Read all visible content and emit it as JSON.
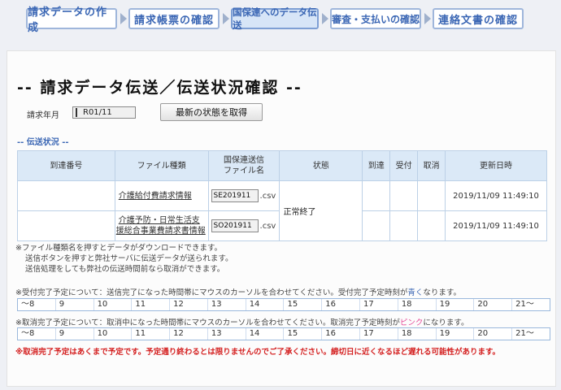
{
  "steps": [
    {
      "label": "請求データの作成",
      "active": false
    },
    {
      "label": "請求帳票の確認",
      "active": false
    },
    {
      "label": "国保連へのデータ伝送",
      "active": true
    },
    {
      "label": "審査・支払いの確認",
      "active": false
    },
    {
      "label": "連絡文書の確認",
      "active": false
    }
  ],
  "page_title": "-- 請求データ伝送／伝送状況確認 --",
  "billing_month": {
    "label": "請求年月",
    "value": "R01/11"
  },
  "refresh_button": "最新の状態を取得",
  "status_section": "-- 伝送状況 --",
  "table": {
    "headers": [
      "到達番号",
      "ファイル種類",
      "国保連送信\nファイル名",
      "状態",
      "到達",
      "受付",
      "取消",
      "更新日時"
    ],
    "rows": [
      {
        "arrival_no": "",
        "file_type": "介護給付費請求情報",
        "file_name": "SE201911",
        "ext": ".csv",
        "state": "",
        "arrived": "",
        "accepted": "",
        "cancelled": "",
        "updated": "2019/11/09 11:49:10"
      },
      {
        "arrival_no": "",
        "file_type": "介護予防・日常生活支援総合事業費請求書情報",
        "file_name": "SO201911",
        "ext": ".csv",
        "state": "",
        "arrived": "",
        "accepted": "",
        "cancelled": "",
        "updated": "2019/11/09 11:49:10"
      }
    ],
    "merged_state": "正常終了"
  },
  "notes": [
    "※ファイル種類名を押すとデータがダウンロードできます。",
    "送信ボタンを押すと弊社サーバに伝送データが送られます。",
    "送信処理をしても弊社の伝送時間前なら取消ができます。"
  ],
  "accept_note": {
    "before": "※受付完了予定について：送信完了になった時間帯にマウスのカーソルを合わせてください。受付完了予定時刻が",
    "highlight": "青く",
    "after": "なります。",
    "highlight_color": "#3a66b4"
  },
  "cancel_note": {
    "before": "※取消完了予定について：取消中になった時間帯にマウスのカーソルを合わせてください。取消完了予定時刻が",
    "highlight": "ピンク",
    "after": "になります。",
    "highlight_color": "#e64d9a"
  },
  "hours": [
    "～8",
    "9",
    "10",
    "11",
    "12",
    "13",
    "14",
    "15",
    "16",
    "17",
    "18",
    "19",
    "20",
    "21～"
  ],
  "warning": "※取消完了予定はあくまで予定です。予定通り終わるとは限りませんのでご了承ください。締切日に近くなるほど遅れる可能性があります。"
}
